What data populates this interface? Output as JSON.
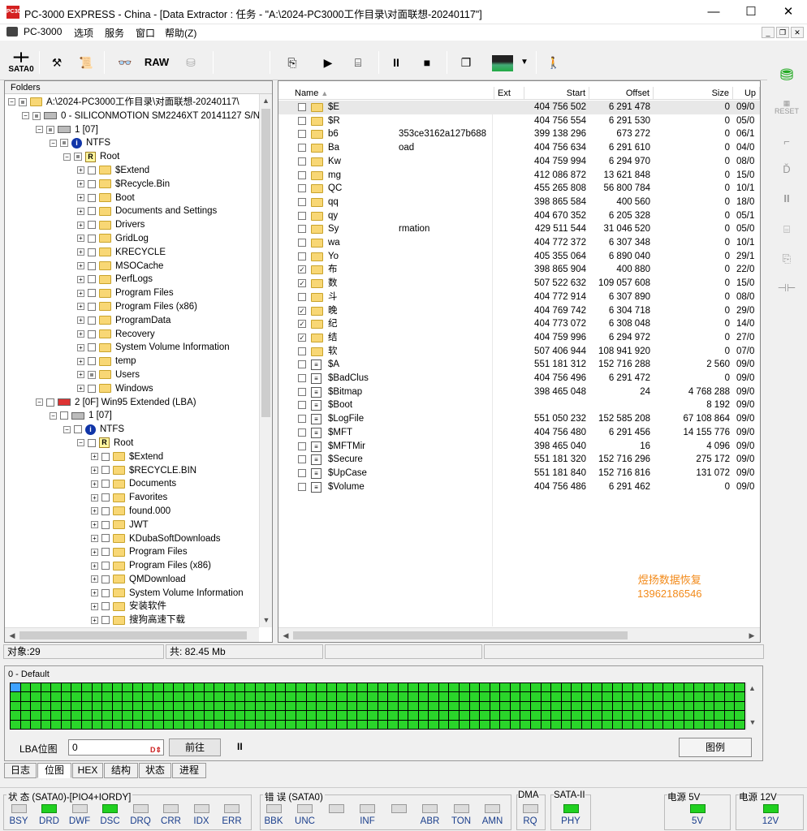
{
  "window": {
    "title": "PC-3000 EXPRESS - China - [Data Extractor : 任务 - \"A:\\2024-PC3000工作目录\\对面联想-20240117\"]",
    "logo": "PC3000"
  },
  "menu": [
    "PC-3000",
    "选项",
    "服务",
    "窗口",
    "帮助(Z)"
  ],
  "toolbar": {
    "sata_label": "SATA0",
    "raw_label": "RAW"
  },
  "folders": {
    "header": "Folders",
    "tree": [
      {
        "indent": 0,
        "pm": "-",
        "cb": "partial",
        "icon": "task",
        "label": "A:\\2024-PC3000工作目录\\对面联想-20240117\\"
      },
      {
        "indent": 1,
        "pm": "-",
        "cb": "partial",
        "icon": "hdd",
        "label": "0 - SILICONMOTION SM2246XT 20141127 S/N:"
      },
      {
        "indent": 2,
        "pm": "-",
        "cb": "partial",
        "icon": "disk",
        "label": "1 [07]"
      },
      {
        "indent": 3,
        "pm": "-",
        "cb": "partial",
        "icon": "info",
        "label": "NTFS"
      },
      {
        "indent": 4,
        "pm": "-",
        "cb": "partial",
        "icon": "root",
        "label": "Root"
      },
      {
        "indent": 5,
        "pm": "+",
        "cb": "",
        "icon": "folder",
        "label": "$Extend"
      },
      {
        "indent": 5,
        "pm": "+",
        "cb": "",
        "icon": "folder",
        "label": "$Recycle.Bin"
      },
      {
        "indent": 5,
        "pm": "+",
        "cb": "",
        "icon": "folder",
        "label": "Boot"
      },
      {
        "indent": 5,
        "pm": "+",
        "cb": "",
        "icon": "folder",
        "label": "Documents and Settings"
      },
      {
        "indent": 5,
        "pm": "+",
        "cb": "",
        "icon": "folder",
        "label": "Drivers"
      },
      {
        "indent": 5,
        "pm": "+",
        "cb": "",
        "icon": "folder",
        "label": "GridLog"
      },
      {
        "indent": 5,
        "pm": "+",
        "cb": "",
        "icon": "folder",
        "label": "KRECYCLE"
      },
      {
        "indent": 5,
        "pm": "+",
        "cb": "",
        "icon": "folder",
        "label": "MSOCache"
      },
      {
        "indent": 5,
        "pm": "+",
        "cb": "",
        "icon": "folder",
        "label": "PerfLogs"
      },
      {
        "indent": 5,
        "pm": "+",
        "cb": "",
        "icon": "folder",
        "label": "Program Files"
      },
      {
        "indent": 5,
        "pm": "+",
        "cb": "",
        "icon": "folder",
        "label": "Program Files (x86)"
      },
      {
        "indent": 5,
        "pm": "+",
        "cb": "",
        "icon": "folder",
        "label": "ProgramData"
      },
      {
        "indent": 5,
        "pm": "+",
        "cb": "",
        "icon": "folder",
        "label": "Recovery"
      },
      {
        "indent": 5,
        "pm": "+",
        "cb": "",
        "icon": "folder",
        "label": "System Volume Information"
      },
      {
        "indent": 5,
        "pm": "+",
        "cb": "",
        "icon": "folder",
        "label": "temp"
      },
      {
        "indent": 5,
        "pm": "+",
        "cb": "partial",
        "icon": "folder",
        "label": "Users"
      },
      {
        "indent": 5,
        "pm": "+",
        "cb": "",
        "icon": "folder",
        "label": "Windows"
      },
      {
        "indent": 2,
        "pm": "-",
        "cb": "",
        "icon": "ext",
        "label": "2 [0F] Win95 Extended  (LBA)"
      },
      {
        "indent": 3,
        "pm": "-",
        "cb": "",
        "icon": "disk",
        "label": "1 [07]"
      },
      {
        "indent": 4,
        "pm": "-",
        "cb": "",
        "icon": "info",
        "label": "NTFS"
      },
      {
        "indent": 5,
        "pm": "-",
        "cb": "",
        "icon": "root",
        "label": "Root"
      },
      {
        "indent": 6,
        "pm": "+",
        "cb": "",
        "icon": "folder",
        "label": "$Extend"
      },
      {
        "indent": 6,
        "pm": "+",
        "cb": "",
        "icon": "folder",
        "label": "$RECYCLE.BIN"
      },
      {
        "indent": 6,
        "pm": "+",
        "cb": "",
        "icon": "folder",
        "label": "Documents"
      },
      {
        "indent": 6,
        "pm": "+",
        "cb": "",
        "icon": "folder",
        "label": "Favorites"
      },
      {
        "indent": 6,
        "pm": "+",
        "cb": "",
        "icon": "folder",
        "label": "found.000"
      },
      {
        "indent": 6,
        "pm": "+",
        "cb": "",
        "icon": "folder",
        "label": "JWT"
      },
      {
        "indent": 6,
        "pm": "+",
        "cb": "",
        "icon": "folder",
        "label": "KDubaSoftDownloads"
      },
      {
        "indent": 6,
        "pm": "+",
        "cb": "",
        "icon": "folder",
        "label": "Program Files"
      },
      {
        "indent": 6,
        "pm": "+",
        "cb": "",
        "icon": "folder",
        "label": "Program Files (x86)"
      },
      {
        "indent": 6,
        "pm": "+",
        "cb": "",
        "icon": "folder",
        "label": "QMDownload"
      },
      {
        "indent": 6,
        "pm": "+",
        "cb": "",
        "icon": "folder",
        "label": "System Volume Information"
      },
      {
        "indent": 6,
        "pm": "+",
        "cb": "",
        "icon": "folder",
        "label": "安装软件"
      },
      {
        "indent": 6,
        "pm": "+",
        "cb": "",
        "icon": "folder",
        "label": "搜狗高速下载"
      }
    ]
  },
  "files": {
    "columns": {
      "name": "Name",
      "ext": "Ext",
      "start": "Start",
      "offset": "Offset",
      "size": "Size",
      "up": "Up"
    },
    "rows": [
      {
        "name": "$E",
        "icon": "folder",
        "checked": false,
        "start": "404 756 502",
        "offset": "6 291 478",
        "size": "0",
        "up": "09/0"
      },
      {
        "name": "$R",
        "icon": "folder",
        "checked": false,
        "start": "404 756 554",
        "offset": "6 291 530",
        "size": "0",
        "up": "05/0"
      },
      {
        "name": "b6",
        "icon": "folder",
        "checked": false,
        "start": "399 138 296",
        "offset": "673 272",
        "size": "0",
        "up": "06/1",
        "tail": "353ce3162a127b688"
      },
      {
        "name": "Ba",
        "icon": "folder",
        "checked": false,
        "start": "404 756 634",
        "offset": "6 291 610",
        "size": "0",
        "up": "04/0",
        "tail": "oad"
      },
      {
        "name": "Kw",
        "icon": "folder",
        "checked": false,
        "start": "404 759 994",
        "offset": "6 294 970",
        "size": "0",
        "up": "08/0"
      },
      {
        "name": "mg",
        "icon": "folder",
        "checked": false,
        "start": "412 086 872",
        "offset": "13 621 848",
        "size": "0",
        "up": "15/0"
      },
      {
        "name": "QC",
        "icon": "folder",
        "checked": false,
        "start": "455 265 808",
        "offset": "56 800 784",
        "size": "0",
        "up": "10/1"
      },
      {
        "name": "qq",
        "icon": "folder",
        "checked": false,
        "start": "398 865 584",
        "offset": "400 560",
        "size": "0",
        "up": "18/0"
      },
      {
        "name": "qy",
        "icon": "folder",
        "checked": false,
        "start": "404 670 352",
        "offset": "6 205 328",
        "size": "0",
        "up": "05/1"
      },
      {
        "name": "Sy",
        "icon": "folder",
        "checked": false,
        "start": "429 511 544",
        "offset": "31 046 520",
        "size": "0",
        "up": "05/0",
        "tail": "rmation"
      },
      {
        "name": "wa",
        "icon": "folder",
        "checked": false,
        "start": "404 772 372",
        "offset": "6 307 348",
        "size": "0",
        "up": "10/1"
      },
      {
        "name": "Yo",
        "icon": "folder",
        "checked": false,
        "start": "405 355 064",
        "offset": "6 890 040",
        "size": "0",
        "up": "29/1"
      },
      {
        "name": "布",
        "icon": "folder",
        "checked": true,
        "start": "398 865 904",
        "offset": "400 880",
        "size": "0",
        "up": "22/0"
      },
      {
        "name": "数",
        "icon": "folder",
        "checked": true,
        "start": "507 522 632",
        "offset": "109 057 608",
        "size": "0",
        "up": "15/0"
      },
      {
        "name": "斗",
        "icon": "folder",
        "checked": false,
        "start": "404 772 914",
        "offset": "6 307 890",
        "size": "0",
        "up": "08/0"
      },
      {
        "name": "晚",
        "icon": "folder",
        "checked": true,
        "start": "404 769 742",
        "offset": "6 304 718",
        "size": "0",
        "up": "29/0"
      },
      {
        "name": "纪",
        "icon": "folder",
        "checked": true,
        "start": "404 773 072",
        "offset": "6 308 048",
        "size": "0",
        "up": "14/0"
      },
      {
        "name": "结",
        "icon": "folder",
        "checked": true,
        "start": "404 759 996",
        "offset": "6 294 972",
        "size": "0",
        "up": "27/0"
      },
      {
        "name": "软",
        "icon": "folder",
        "checked": false,
        "start": "507 406 944",
        "offset": "108 941 920",
        "size": "0",
        "up": "07/0"
      },
      {
        "name": "$A",
        "icon": "file",
        "checked": false,
        "start": "551 181 312",
        "offset": "152 716 288",
        "size": "2 560",
        "up": "09/0"
      },
      {
        "name": "$BadClus",
        "icon": "file",
        "checked": false,
        "start": "404 756 496",
        "offset": "6 291 472",
        "size": "0",
        "up": "09/0"
      },
      {
        "name": "$Bitmap",
        "icon": "file",
        "checked": false,
        "start": "398 465 048",
        "offset": "24",
        "size": "4 768 288",
        "up": "09/0"
      },
      {
        "name": "$Boot",
        "icon": "file",
        "checked": false,
        "start": "",
        "offset": "",
        "size": "8 192",
        "up": "09/0"
      },
      {
        "name": "$LogFile",
        "icon": "file",
        "checked": false,
        "start": "551 050 232",
        "offset": "152 585 208",
        "size": "67 108 864",
        "up": "09/0"
      },
      {
        "name": "$MFT",
        "icon": "file",
        "checked": false,
        "start": "404 756 480",
        "offset": "6 291 456",
        "size": "14 155 776",
        "up": "09/0"
      },
      {
        "name": "$MFTMir",
        "icon": "file",
        "checked": false,
        "start": "398 465 040",
        "offset": "16",
        "size": "4 096",
        "up": "09/0"
      },
      {
        "name": "$Secure",
        "icon": "file",
        "checked": false,
        "start": "551 181 320",
        "offset": "152 716 296",
        "size": "275 172",
        "up": "09/0"
      },
      {
        "name": "$UpCase",
        "icon": "file",
        "checked": false,
        "start": "551 181 840",
        "offset": "152 716 816",
        "size": "131 072",
        "up": "09/0"
      },
      {
        "name": "$Volume",
        "icon": "file",
        "checked": false,
        "start": "404 756 486",
        "offset": "6 291 462",
        "size": "0",
        "up": "09/0"
      }
    ],
    "watermark": [
      "煜扬数据恢复",
      "13962186546"
    ],
    "watermark_color": "#f28a1a"
  },
  "status": {
    "objects": "对象:29",
    "total": "共: 82.45 Mb"
  },
  "bitmap": {
    "title": "0 - Default",
    "lba_label": "LBA位图",
    "lba_value": "0",
    "go_label": "前往",
    "legend_label": "图例",
    "pause_symbol": "II"
  },
  "tabs": [
    "日志",
    "位图",
    "HEX",
    "结构",
    "状态",
    "进程"
  ],
  "active_tab": "位图",
  "indicators": {
    "status_title": "状 态 (SATA0)-[PIO4+IORDY]",
    "error_title": "错 误 (SATA0)",
    "dma_title": "DMA",
    "sata_title": "SATA-II",
    "p5_title": "电源 5V",
    "p12_title": "电源 12V",
    "status_leds": [
      {
        "label": "BSY",
        "on": false
      },
      {
        "label": "DRD",
        "on": true
      },
      {
        "label": "DWF",
        "on": false
      },
      {
        "label": "DSC",
        "on": true
      },
      {
        "label": "DRQ",
        "on": false
      },
      {
        "label": "CRR",
        "on": false
      },
      {
        "label": "IDX",
        "on": false
      },
      {
        "label": "ERR",
        "on": false
      }
    ],
    "error_leds": [
      {
        "label": "BBK",
        "on": false
      },
      {
        "label": "UNC",
        "on": false
      },
      {
        "label": "",
        "on": false
      },
      {
        "label": "INF",
        "on": false
      },
      {
        "label": "",
        "on": false
      },
      {
        "label": "ABR",
        "on": false
      },
      {
        "label": "TON",
        "on": false
      },
      {
        "label": "AMN",
        "on": false
      }
    ],
    "dma_led": {
      "label": "RQ",
      "on": false
    },
    "sata_led": {
      "label": "PHY",
      "on": true
    },
    "p5_led": {
      "label": "5V",
      "on": true
    },
    "p12_led": {
      "label": "12V",
      "on": true
    }
  },
  "colors": {
    "led_on": "#20d020",
    "grid_green": "#2ad52a",
    "grid_first": "#3fa2ff"
  }
}
